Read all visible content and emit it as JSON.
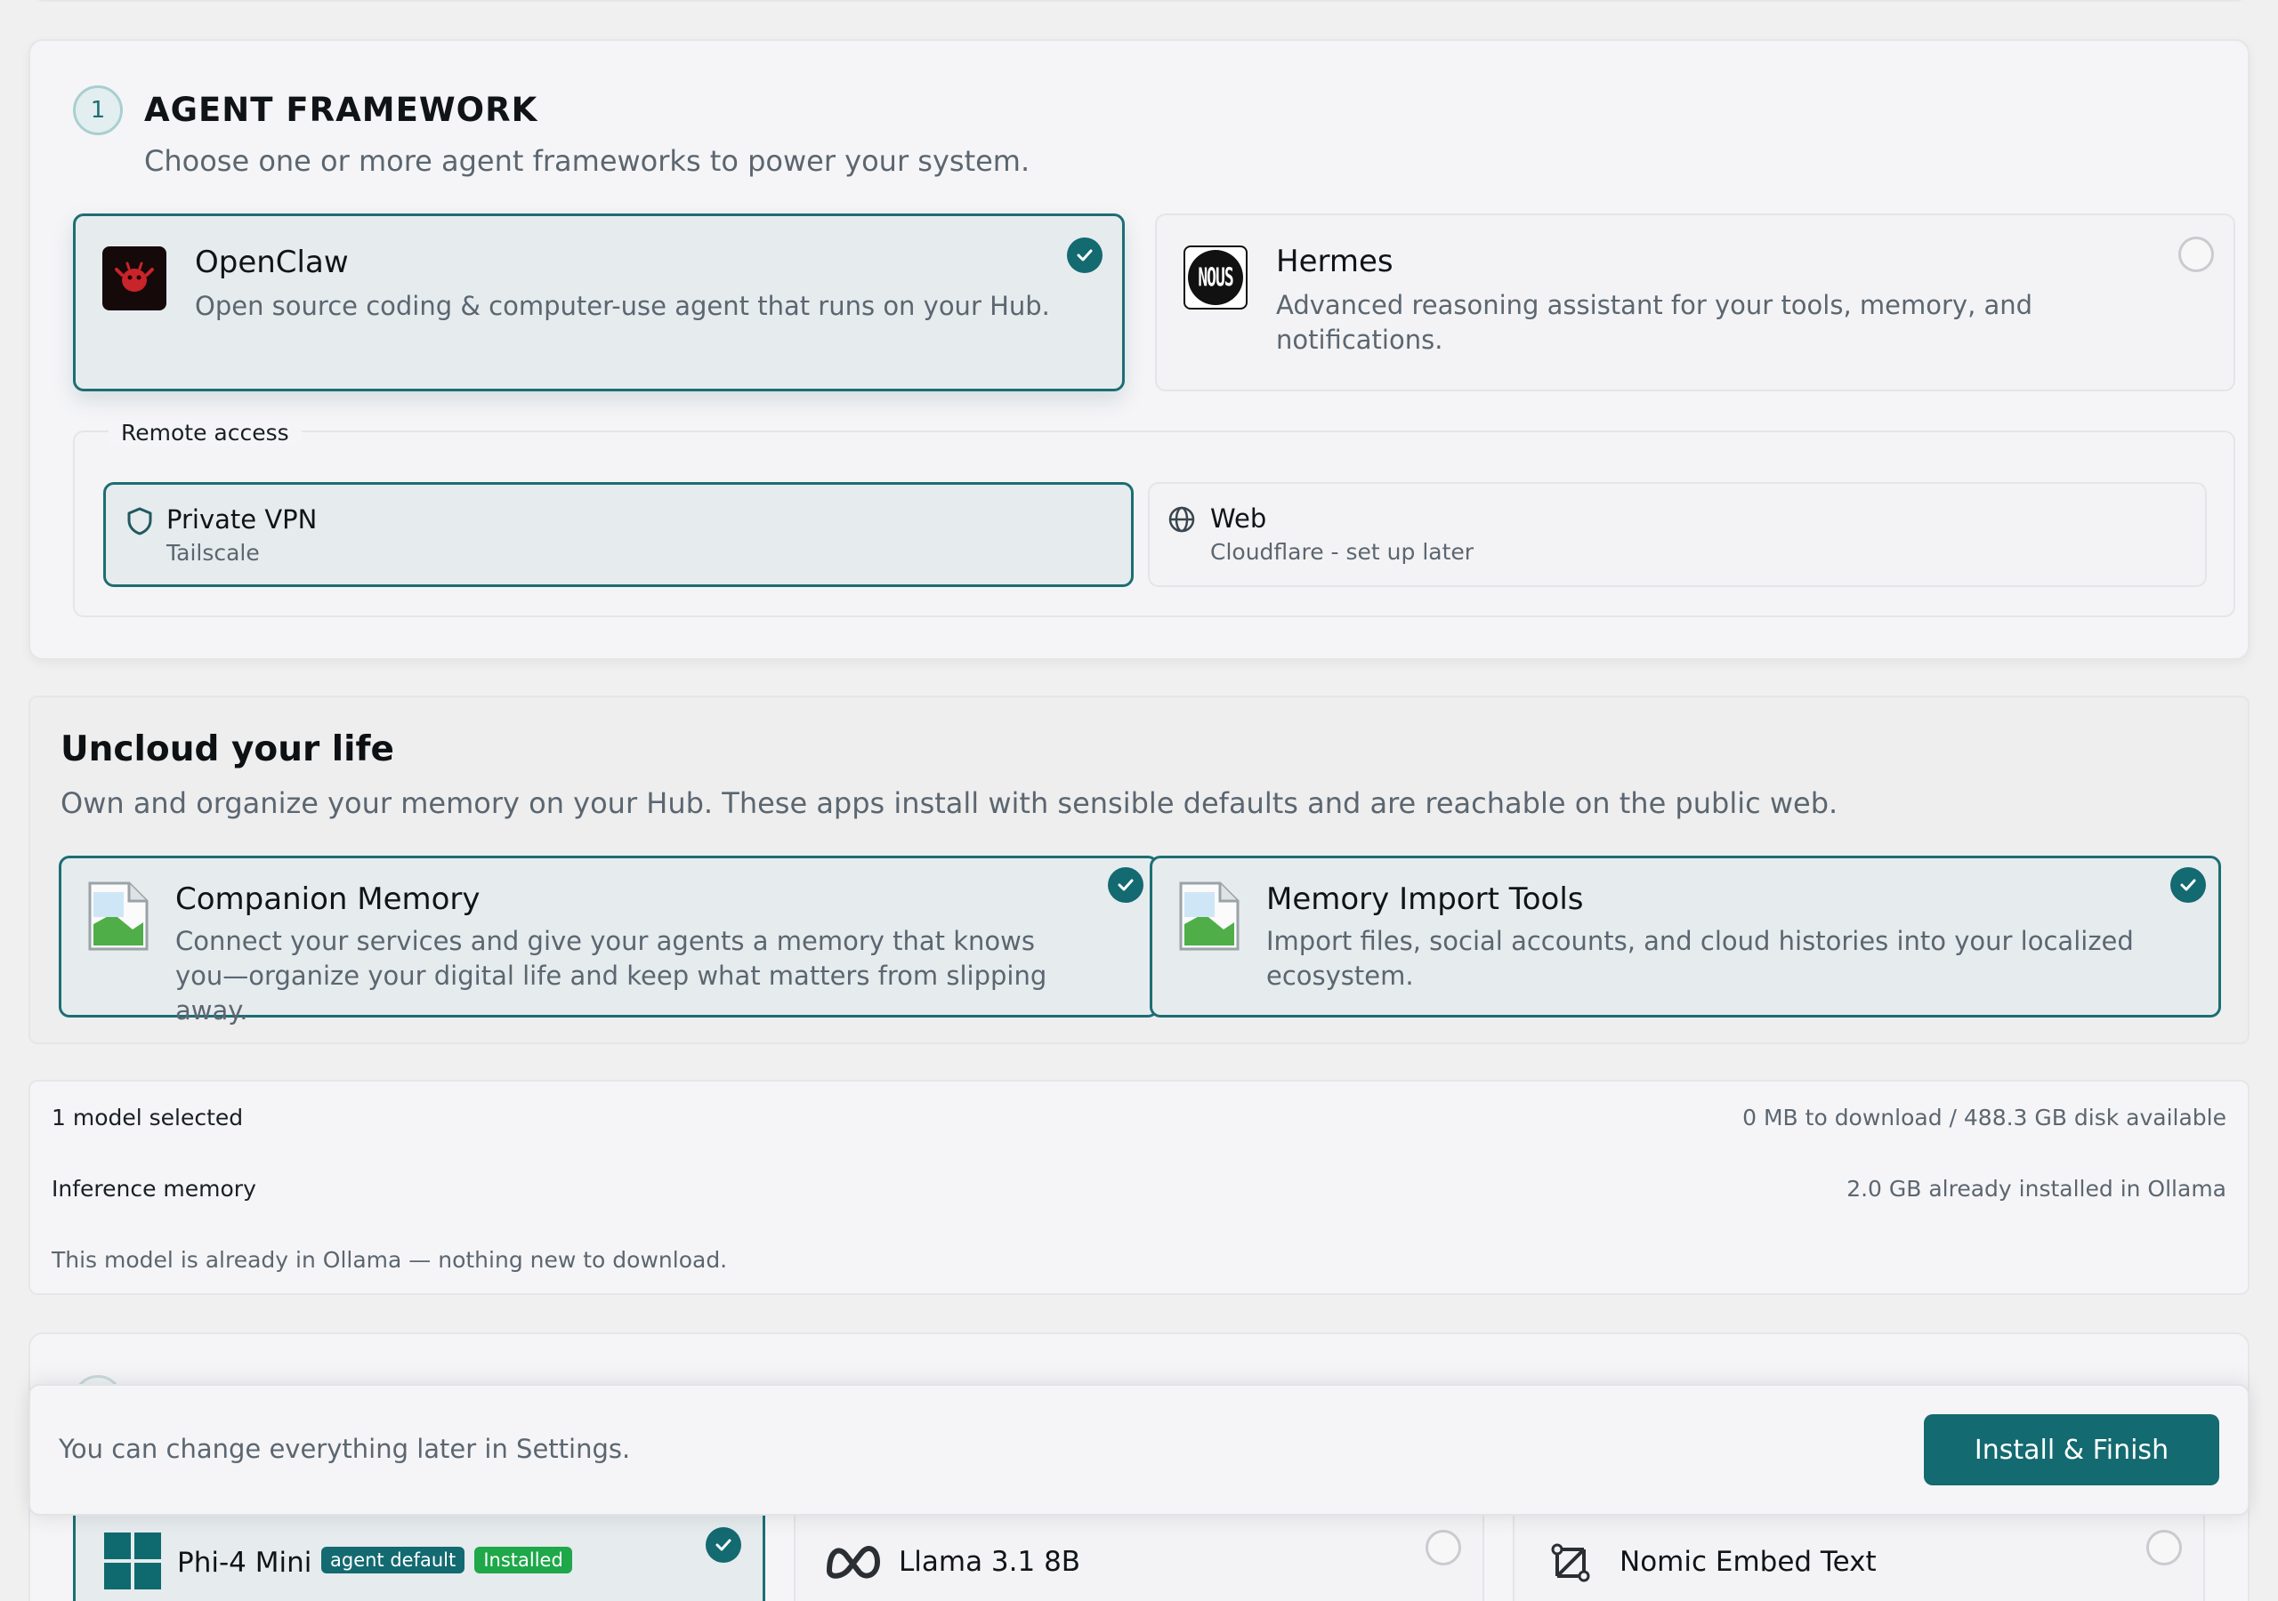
{
  "agent_section": {
    "step": "1",
    "title": "AGENT FRAMEWORK",
    "subtitle": "Choose one or more agent frameworks to power your system.",
    "frameworks": [
      {
        "name": "OpenClaw",
        "description": "Open source coding & computer-use agent that runs on your Hub.",
        "selected": true
      },
      {
        "name": "Hermes",
        "description": "Advanced reasoning assistant for your tools, memory, and notifications.",
        "selected": false,
        "logo_text": "NOUS"
      }
    ],
    "remote_access": {
      "label": "Remote access",
      "options": [
        {
          "name": "Private VPN",
          "sub": "Tailscale",
          "icon": "shield-icon",
          "selected": true
        },
        {
          "name": "Web",
          "sub": "Cloudflare - set up later",
          "icon": "globe-icon",
          "selected": false
        }
      ]
    }
  },
  "uncloud_section": {
    "title": "Uncloud your life",
    "subtitle": "Own and organize your memory on your Hub. These apps install with sensible defaults and are reachable on the public web.",
    "apps": [
      {
        "name": "Companion Memory",
        "description": "Connect your services and give your agents a memory that knows you—organize your digital life and keep what matters from slipping away.",
        "selected": true
      },
      {
        "name": "Memory Import Tools",
        "description": "Import files, social accounts, and cloud histories into your localized ecosystem.",
        "selected": true
      }
    ]
  },
  "model_summary": {
    "selected": "1 model selected",
    "download": "0 MB to download / 488.3 GB disk available",
    "memory_label": "Inference memory",
    "memory_value": "2.0 GB already installed in Ollama",
    "note": "This model is already in Ollama — nothing new to download."
  },
  "footer": {
    "note": "You can change everything later in Settings.",
    "install_label": "Install & Finish"
  },
  "models": [
    {
      "name": "Phi-4 Mini",
      "badges": [
        "agent default",
        "Installed"
      ],
      "selected": true
    },
    {
      "name": "Llama 3.1 8B",
      "selected": false
    },
    {
      "name": "Nomic Embed Text",
      "selected": false
    }
  ],
  "colors": {
    "accent": "#136a70",
    "installed_badge": "#1ea84a"
  }
}
